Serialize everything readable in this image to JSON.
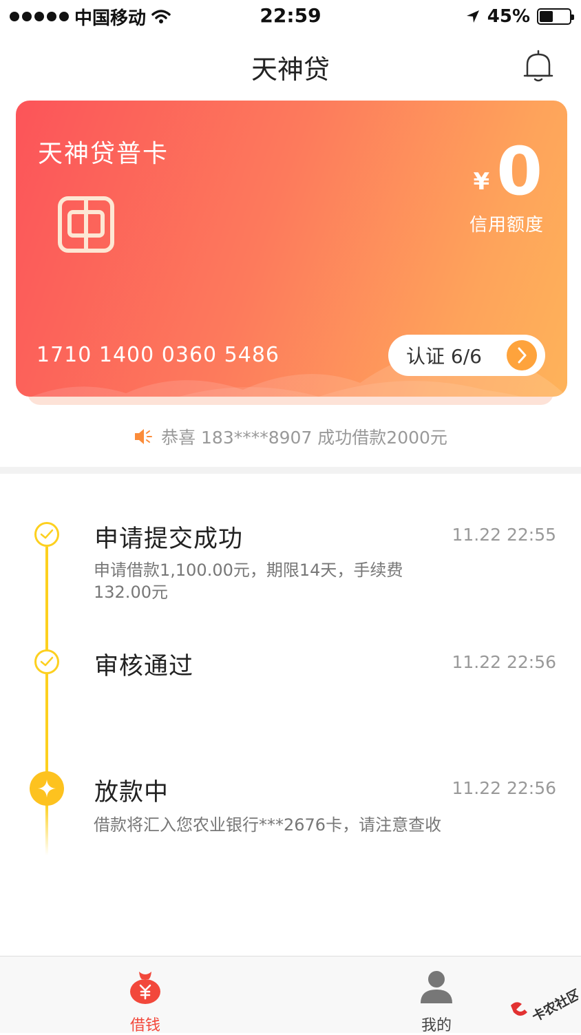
{
  "status_bar": {
    "carrier": "中国移动",
    "time": "22:59",
    "battery": "45%"
  },
  "nav": {
    "title": "天神贷"
  },
  "card": {
    "name": "天神贷普卡",
    "currency": "¥",
    "credit_limit": "0",
    "credit_limit_label": "信用额度",
    "card_number": "1710 1400 0360 5486",
    "auth_status": "认证 6/6"
  },
  "notice": {
    "text": "恭喜 183****8907 成功借款2000元"
  },
  "timeline": [
    {
      "title": "申请提交成功",
      "time": "11.22 22:55",
      "desc": "申请借款1,100.00元，期限14天，手续费132.00元"
    },
    {
      "title": "审核通过",
      "time": "11.22 22:56",
      "desc": ""
    },
    {
      "title": "放款中",
      "time": "11.22 22:56",
      "desc": "借款将汇入您农业银行***2676卡，请注意查收"
    }
  ],
  "tabs": [
    {
      "label": "借钱",
      "icon": "money-bag-icon",
      "active": true
    },
    {
      "label": "我的",
      "icon": "user-icon",
      "active": false
    }
  ],
  "watermark": {
    "text": "卡农社区"
  },
  "colors": {
    "card_gradient_start": "#fc5459",
    "card_gradient_end": "#feb35a",
    "timeline_yellow": "#fdd01f",
    "active_tab": "#f2483b",
    "inactive_tab": "#666666",
    "auth_arrow": "#fea33c"
  }
}
